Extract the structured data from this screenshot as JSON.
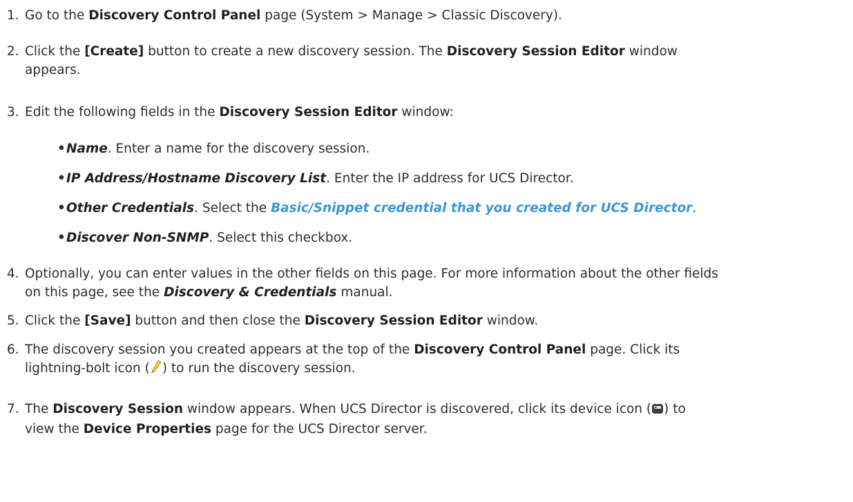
{
  "steps": [
    {
      "num": "1.",
      "t1": "Go to the ",
      "b1": "Discovery Control Panel",
      "t2": " page (System > Manage > Classic Discovery)."
    },
    {
      "num": "2.",
      "t1": "Click the ",
      "b1": "[Create]",
      "t2": " button to create a new discovery session. The ",
      "b2": "Discovery Session Editor",
      "t3": " window",
      "line2": "appears."
    },
    {
      "num": "3.",
      "t1": "Edit the following fields in the ",
      "b1": "Discovery Session Editor",
      "t2": " window:"
    },
    {
      "num": "4.",
      "line1": "Optionally, you can enter values in the other fields on this page. For more information about the other fields",
      "t1": "on this page, see the ",
      "b1": "Discovery & Credentials",
      "t2": " manual."
    },
    {
      "num": "5.",
      "t1": "Click the ",
      "b1": "[Save]",
      "t2": " button and then close the ",
      "b2": "Discovery Session Editor",
      "t3": " window."
    },
    {
      "num": "6.",
      "t1": "The discovery session you created appears at the top of the ",
      "b1": "Discovery Control Panel",
      "t2": " page. Click its",
      "t3": "lightning-bolt icon (",
      "t4": ") to run the discovery session."
    },
    {
      "num": "7.",
      "t1": "The ",
      "b1": "Discovery Session",
      "t2": " window appears. When UCS Director is discovered, click its device icon (",
      "t3": ") to",
      "t4": "view the ",
      "b2": "Device Properties",
      "t5": " page for the UCS Director server."
    }
  ],
  "bullets": [
    {
      "label": "Name",
      "t1": ". Enter a name for the discovery session."
    },
    {
      "label": "IP Address/Hostname Discovery List",
      "t1": ". Enter the IP address for UCS Director."
    },
    {
      "label": "Other Credentials",
      "t1": ". Select the ",
      "link": "Basic/Snippet credential that you created for UCS Director",
      "t2": "."
    },
    {
      "label": "Discover Non-SNMP",
      "t1": ". Select this checkbox."
    }
  ],
  "colors": {
    "link": "#3b96d2",
    "text": "#2b2b2b"
  },
  "icons": {
    "lightning": "lightning-bolt-icon",
    "device": "device-icon"
  }
}
